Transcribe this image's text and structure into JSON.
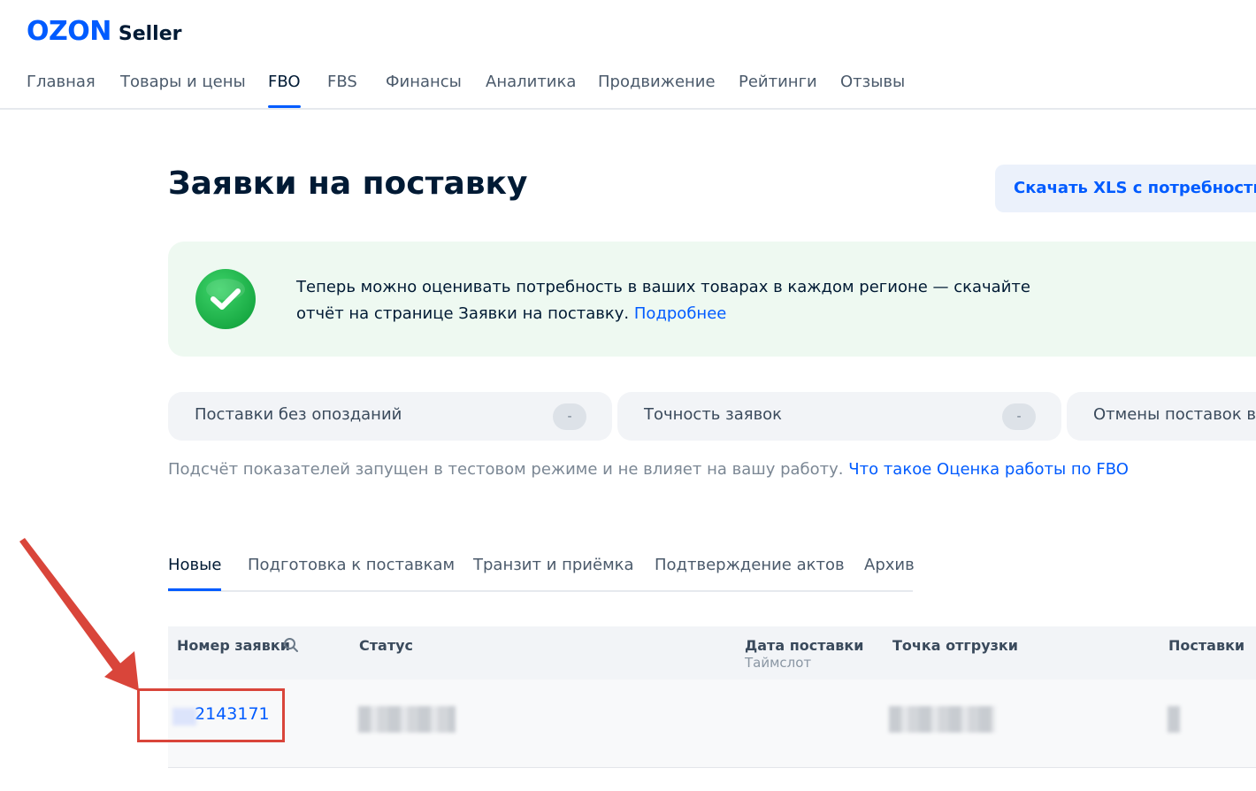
{
  "logo": {
    "brand": "OZON",
    "product": "Seller"
  },
  "nav": {
    "items": [
      "Главная",
      "Товары и цены",
      "FBO",
      "FBS",
      "Финансы",
      "Аналитика",
      "Продвижение",
      "Рейтинги",
      "Отзывы"
    ],
    "active": "FBO"
  },
  "page": {
    "title": "Заявки на поставку",
    "download_button": "Скачать XLS с потребностью"
  },
  "banner": {
    "text": "Теперь можно оценивать потребность в ваших товарах в каждом регионе — скачайте отчёт на странице Заявки на поставку.",
    "link": "Подробнее",
    "icon": "check-circle-icon",
    "icon_color": "#1cb34f"
  },
  "metrics": [
    {
      "label": "Поставки без опозданий",
      "value": "-"
    },
    {
      "label": "Точность заявок",
      "value": "-"
    },
    {
      "label": "Отмены поставок во",
      "value": ""
    }
  ],
  "note": {
    "text": "Подсчёт показателей запущен в тестовом режиме и не влияет на вашу работу.",
    "link": "Что такое Оценка работы по FBO"
  },
  "tabs": {
    "items": [
      "Новые",
      "Подготовка к поставкам",
      "Транзит и приёмка",
      "Подтверждение актов",
      "Архив"
    ],
    "active": "Новые"
  },
  "table": {
    "columns": {
      "order": "Номер заявки",
      "status": "Статус",
      "date": "Дата поставки",
      "date_sub": "Таймслот",
      "point": "Точка отгрузки",
      "supplies": "Поставки"
    },
    "rows": [
      {
        "order": "2143171"
      }
    ]
  },
  "colors": {
    "accent": "#005bff",
    "annotation": "#d9453a"
  }
}
